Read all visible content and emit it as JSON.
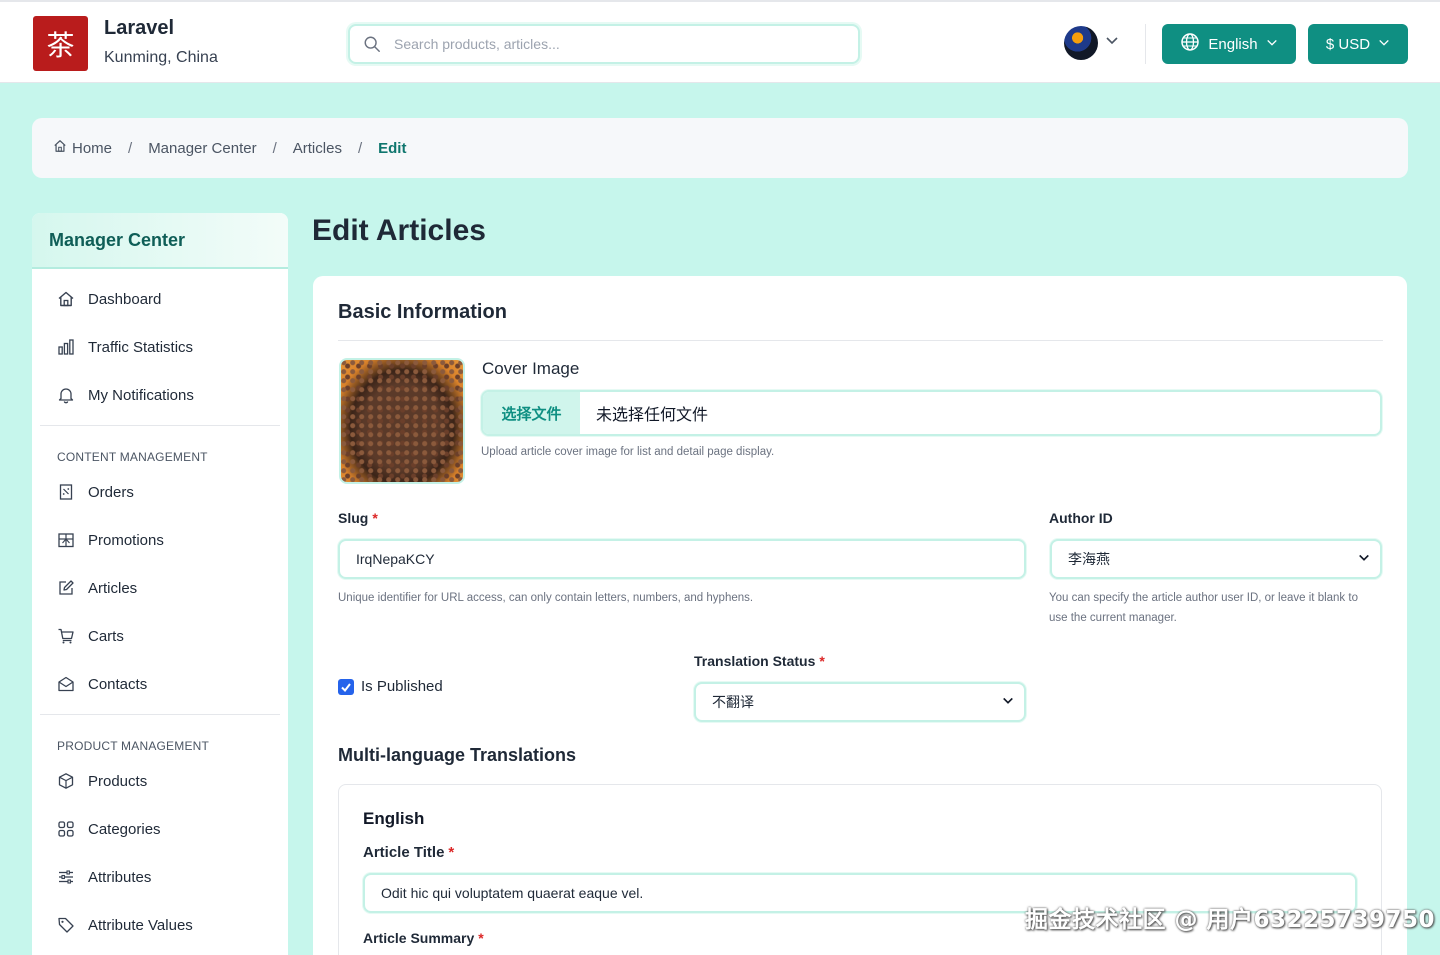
{
  "header": {
    "logo_char": "茶",
    "brand_name": "Laravel",
    "brand_location": "Kunming, China",
    "search_placeholder": "Search products, articles...",
    "language_label": "English",
    "currency_label": "$ USD"
  },
  "breadcrumb": {
    "items": [
      "Home",
      "Manager Center",
      "Articles",
      "Edit"
    ],
    "separator": "/"
  },
  "sidebar": {
    "title": "Manager Center",
    "top_items": [
      {
        "label": "Dashboard",
        "icon": "home-icon"
      },
      {
        "label": "Traffic Statistics",
        "icon": "bar-chart-icon"
      },
      {
        "label": "My Notifications",
        "icon": "bell-icon"
      }
    ],
    "content_section": "CONTENT MANAGEMENT",
    "content_items": [
      {
        "label": "Orders",
        "icon": "receipt-icon"
      },
      {
        "label": "Promotions",
        "icon": "gift-icon"
      },
      {
        "label": "Articles",
        "icon": "pencil-square-icon"
      },
      {
        "label": "Carts",
        "icon": "cart-icon"
      },
      {
        "label": "Contacts",
        "icon": "envelope-open-icon"
      }
    ],
    "product_section": "PRODUCT MANAGEMENT",
    "product_items": [
      {
        "label": "Products",
        "icon": "box-icon"
      },
      {
        "label": "Categories",
        "icon": "grid-icon"
      },
      {
        "label": "Attributes",
        "icon": "sliders-icon"
      },
      {
        "label": "Attribute Values",
        "icon": "tag-icon"
      }
    ]
  },
  "main": {
    "page_title": "Edit Articles",
    "card_title": "Basic Information",
    "cover": {
      "label": "Cover Image",
      "choose_button": "选择文件",
      "file_status": "未选择任何文件",
      "help": "Upload article cover image for list and detail page display."
    },
    "slug": {
      "label": "Slug",
      "required": "*",
      "value": "IrqNepaKCY",
      "help": "Unique identifier for URL access, can only contain letters, numbers, and hyphens."
    },
    "author": {
      "label": "Author ID",
      "value": "李海燕",
      "help_line1": "You can specify the article author user ID, or leave it blank to",
      "help_line2": "use the current manager."
    },
    "is_published": {
      "label": "Is Published",
      "checked": true
    },
    "translation_status": {
      "label": "Translation Status",
      "required": "*",
      "value": "不翻译"
    },
    "translations": {
      "title": "Multi-language Translations",
      "language": "English",
      "article_title_label": "Article Title",
      "article_title_required": "*",
      "article_title_value": "Odit hic qui voluptatem quaerat eaque vel.",
      "article_summary_label": "Article Summary",
      "article_summary_required": "*"
    }
  },
  "watermark": "掘金技术社区 @ 用户63225739750",
  "colors": {
    "page_bg": "#c6f6ec",
    "accent": "#0f8f82",
    "logo_bg": "#b91c1c",
    "required": "#dc2626",
    "checkbox": "#2563eb"
  }
}
